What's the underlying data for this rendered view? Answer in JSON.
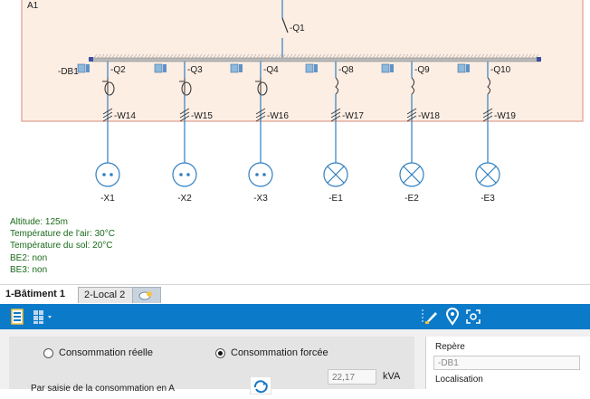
{
  "diagram": {
    "frame_label": "A1",
    "breaker_main": "-Q1",
    "busbar": "-DB1",
    "feeders": [
      {
        "breaker": "-Q2",
        "cable": "-W14",
        "load": "-X1",
        "load_type": "socket"
      },
      {
        "breaker": "-Q3",
        "cable": "-W15",
        "load": "-X2",
        "load_type": "socket"
      },
      {
        "breaker": "-Q4",
        "cable": "-W16",
        "load": "-X3",
        "load_type": "socket"
      },
      {
        "breaker": "-Q8",
        "cable": "-W17",
        "load": "-E1",
        "load_type": "lamp"
      },
      {
        "breaker": "-Q9",
        "cable": "-W18",
        "load": "-E2",
        "load_type": "lamp"
      },
      {
        "breaker": "-Q10",
        "cable": "-W19",
        "load": "-E3",
        "load_type": "lamp"
      }
    ],
    "colors": {
      "zone_fill": "#fdeee4",
      "zone_border": "#d98a7a",
      "wire": "#2f7fc0",
      "bus": "#8a8a8a"
    }
  },
  "environment": [
    "Altitude: 125m",
    "Température de l'air: 30°C",
    "Température du sol: 20°C",
    "BE2: non",
    "BE3: non"
  ],
  "tabs": [
    {
      "label": "1-Bâtiment 1",
      "active": true
    },
    {
      "label": "2-Local 2",
      "active": false
    }
  ],
  "toolbar": {
    "color": "#0a7ac9"
  },
  "properties": {
    "radio_real": "Consommation réelle",
    "radio_forced": "Consommation forcée",
    "selected": "forced",
    "hint": "Par saisie de la consommation en A",
    "value": "22,17",
    "unit": "kVA",
    "repere_label": "Repère",
    "repere_value": "-DB1",
    "localisation_label": "Localisation"
  }
}
